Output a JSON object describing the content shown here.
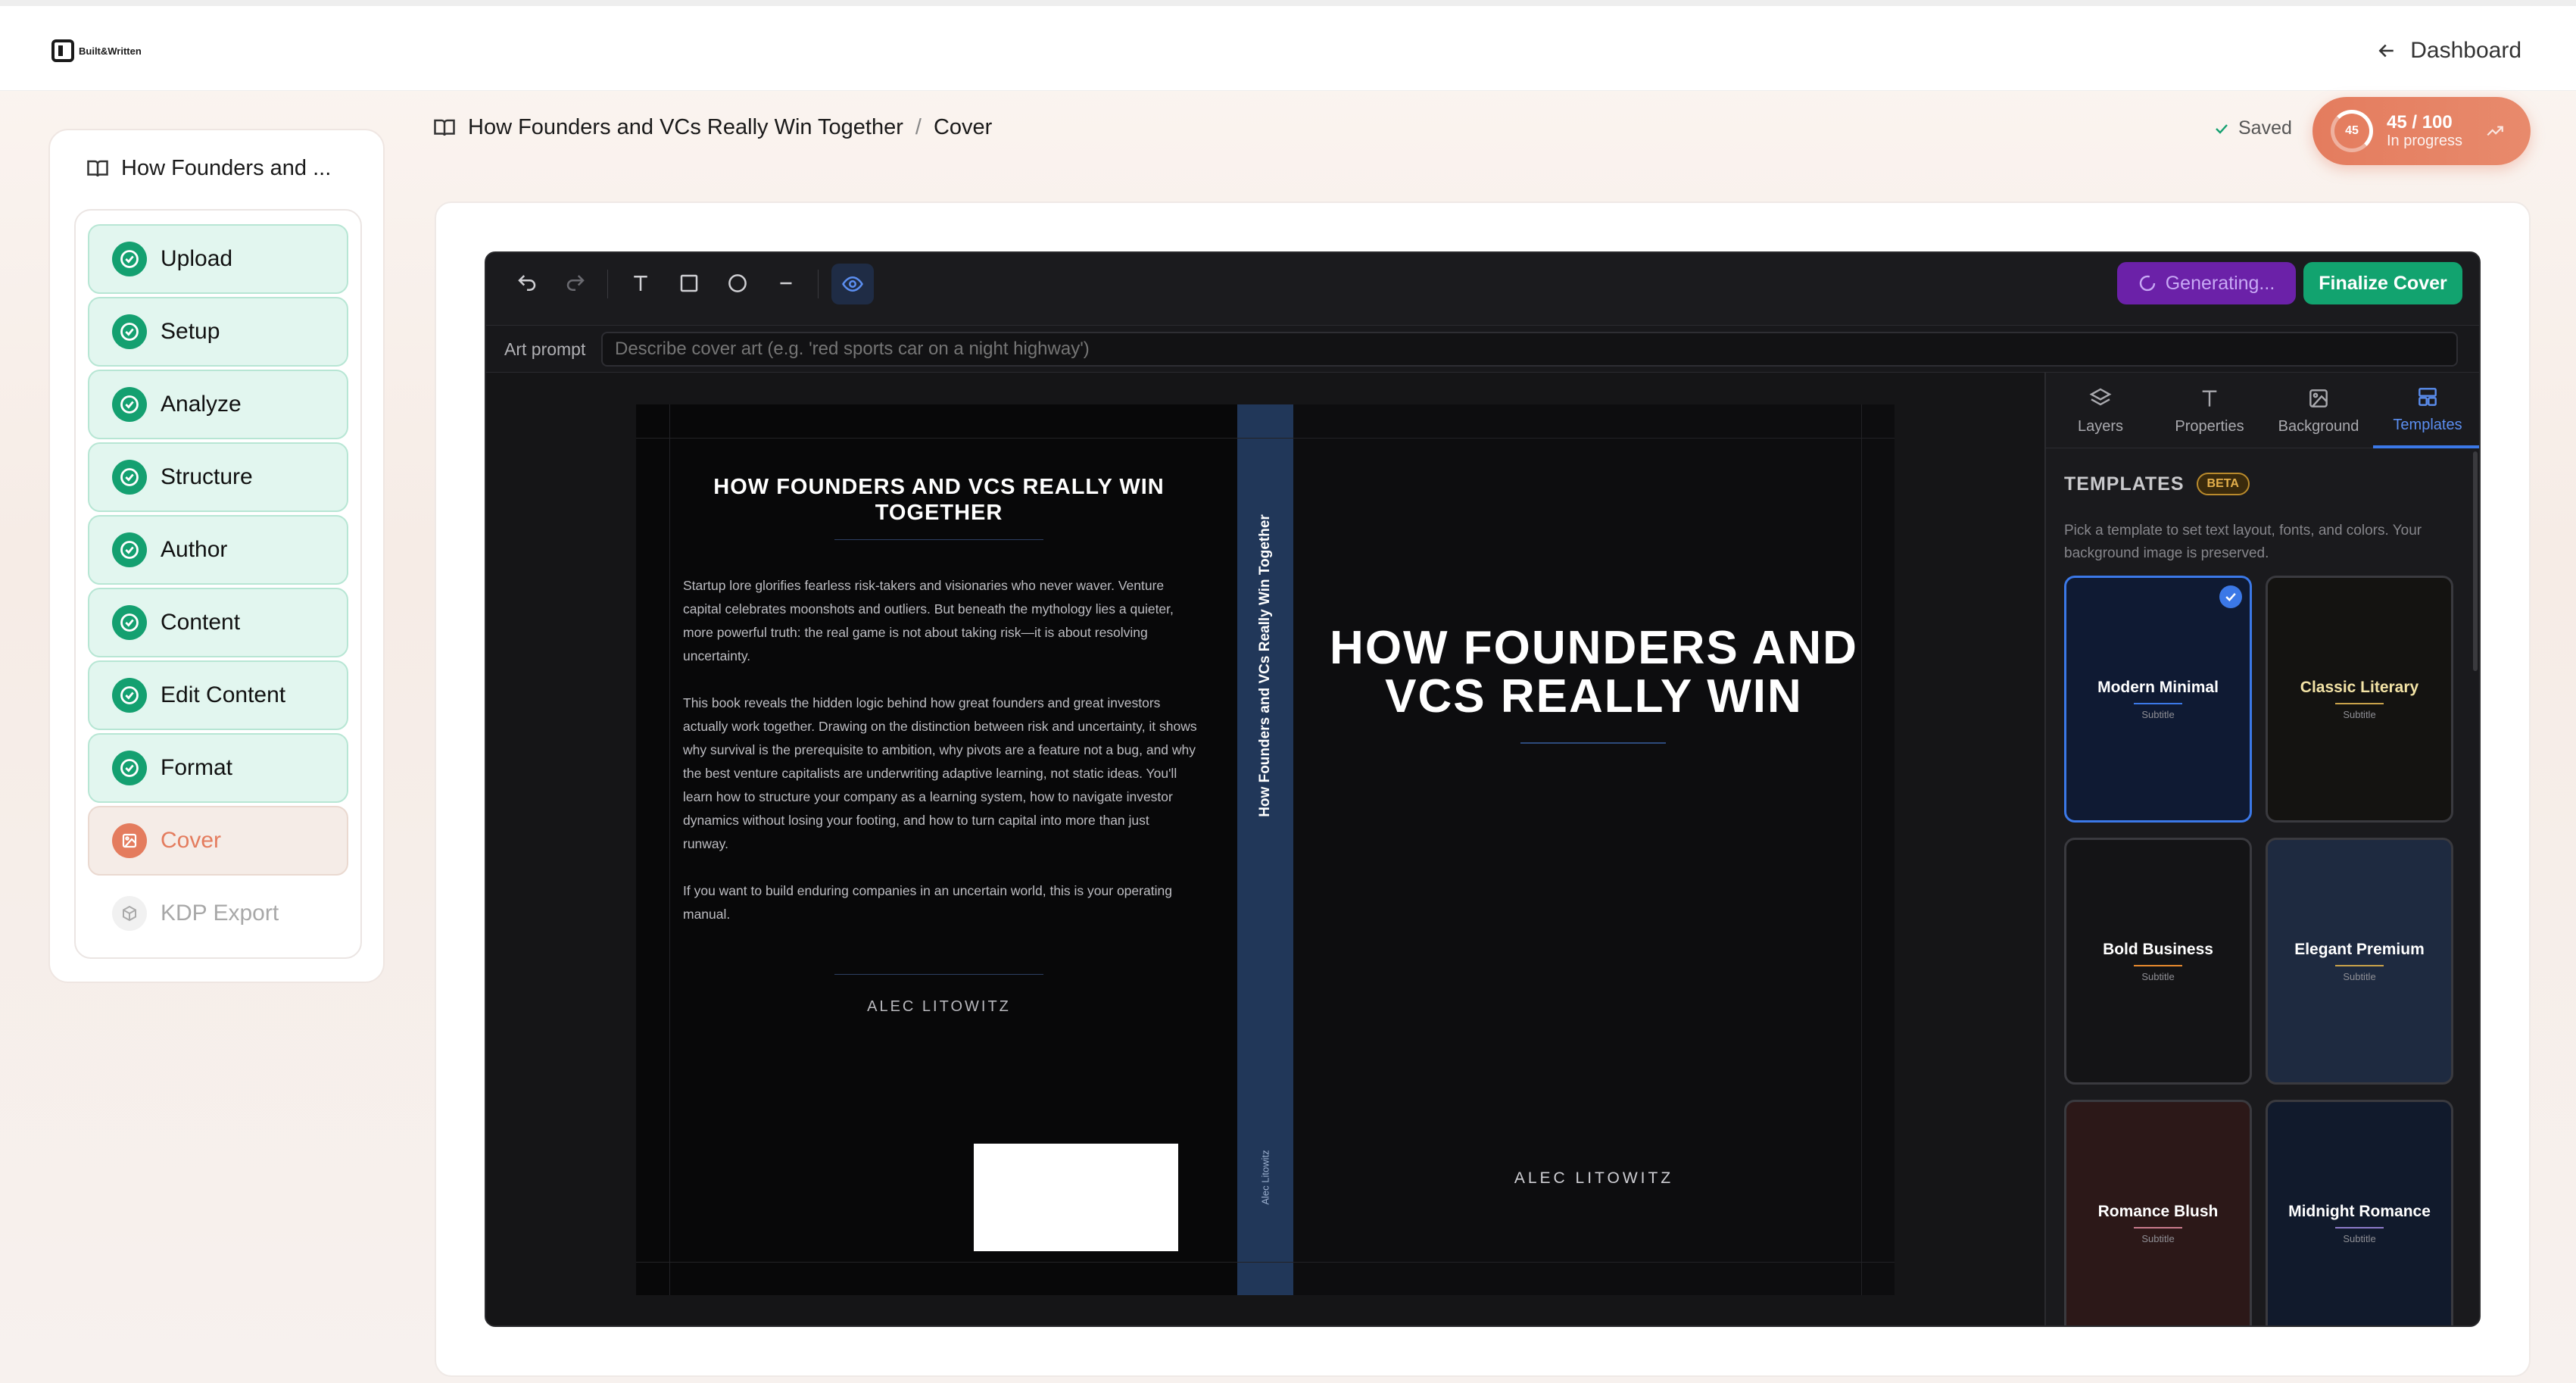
{
  "app": {
    "logo_text": "Built&Written",
    "dashboard_label": "Dashboard"
  },
  "sidebar": {
    "book_title": "How Founders and ...",
    "steps": [
      {
        "label": "Upload",
        "state": "done"
      },
      {
        "label": "Setup",
        "state": "done"
      },
      {
        "label": "Analyze",
        "state": "done"
      },
      {
        "label": "Structure",
        "state": "done"
      },
      {
        "label": "Author",
        "state": "done"
      },
      {
        "label": "Content",
        "state": "done"
      },
      {
        "label": "Edit Content",
        "state": "done"
      },
      {
        "label": "Format",
        "state": "done"
      },
      {
        "label": "Cover",
        "state": "active"
      },
      {
        "label": "KDP Export",
        "state": "disabled"
      }
    ]
  },
  "breadcrumb": {
    "book": "How Founders and VCs Really Win Together",
    "separator": "/",
    "page": "Cover"
  },
  "status": {
    "saved": "Saved",
    "progress_ring": "45",
    "progress_value": "45 / 100",
    "progress_label": "In progress",
    "progress_fraction": 0.45
  },
  "toolbar": {
    "generating_label": "Generating...",
    "finalize_label": "Finalize Cover"
  },
  "prompt": {
    "label": "Art prompt",
    "placeholder": "Describe cover art (e.g. 'red sports car on a night highway')"
  },
  "cover": {
    "back_title": "HOW FOUNDERS AND VCS REALLY WIN TOGETHER",
    "back_paragraphs": [
      "Startup lore glorifies fearless risk-takers and visionaries who never waver. Venture capital celebrates moonshots and outliers. But beneath the mythology lies a quieter, more powerful truth: the real game is not about taking risk—it is about resolving uncertainty.",
      "This book reveals the hidden logic behind how great founders and great investors actually work together. Drawing on the distinction between risk and uncertainty, it shows why survival is the prerequisite to ambition, why pivots are a feature not a bug, and why the best venture capitalists are underwriting adaptive learning, not static ideas. You'll learn how to structure your company as a learning system, how to navigate investor dynamics without losing your footing, and how to turn capital into more than just runway.",
      "If you want to build enduring companies in an uncertain world, this is your operating manual."
    ],
    "back_author": "ALEC LITOWITZ",
    "spine_title": "How Founders and VCs Really Win Together",
    "spine_author": "Alec Litowitz",
    "front_title": "HOW FOUNDERS AND VCS REALLY WIN",
    "front_author": "ALEC LITOWITZ",
    "colors": {
      "spine": "#213759",
      "back": "#080809",
      "front": "#0d0d0f"
    }
  },
  "panel": {
    "tabs": [
      {
        "label": "Layers",
        "icon": "layers-icon"
      },
      {
        "label": "Properties",
        "icon": "text-icon"
      },
      {
        "label": "Background",
        "icon": "image-icon"
      },
      {
        "label": "Templates",
        "icon": "templates-icon",
        "active": true
      }
    ],
    "templates_title": "TEMPLATES",
    "beta_badge": "BETA",
    "templates_desc": "Pick a template to set text layout, fonts, and colors. Your background image is preserved.",
    "templates": [
      {
        "name": "Modern Minimal",
        "subtitle": "Subtitle",
        "bg": "#0f1a33",
        "text": "#ffffff",
        "accent": "#3b78e7",
        "selected": true
      },
      {
        "name": "Classic Literary",
        "subtitle": "Subtitle",
        "bg": "#141311",
        "text": "#f3e3a6",
        "accent": "#c9a24a",
        "selected": false
      },
      {
        "name": "Bold Business",
        "subtitle": "Subtitle",
        "bg": "#141416",
        "text": "#ffffff",
        "accent": "#e88a2e",
        "selected": false
      },
      {
        "name": "Elegant Premium",
        "subtitle": "Subtitle",
        "bg": "#1e2a40",
        "text": "#ffffff",
        "accent": "#c9a24a",
        "selected": false
      },
      {
        "name": "Romance Blush",
        "subtitle": "Subtitle",
        "bg": "#2c1818",
        "text": "#ffffff",
        "accent": "#c97a8c",
        "selected": false
      },
      {
        "name": "Midnight Romance",
        "subtitle": "Subtitle",
        "bg": "#111a2c",
        "text": "#ffffff",
        "accent": "#8c7ac9",
        "selected": false
      }
    ]
  }
}
